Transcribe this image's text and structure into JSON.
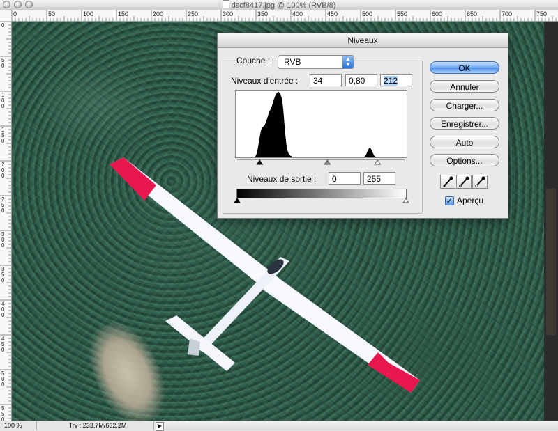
{
  "window": {
    "title": "dscf8417.jpg @ 100% (RVB/8)"
  },
  "rulers": {
    "top_ticks": [
      "0",
      "50",
      "100",
      "150",
      "200",
      "250",
      "300",
      "350",
      "400",
      "450",
      "500",
      "550",
      "600",
      "650",
      "700",
      "750"
    ],
    "left_ticks": [
      "0",
      "50",
      "100",
      "150",
      "200",
      "250",
      "300",
      "350",
      "400",
      "450",
      "500",
      "550"
    ]
  },
  "status": {
    "zoom": "100 %",
    "doc_info": "Trv : 233,7M/632,2M"
  },
  "dialog": {
    "title": "Niveaux",
    "channel_label": "Couche :",
    "channel_value": "RVB",
    "input_label": "Niveaux d'entrée :",
    "input_black": "34",
    "input_gamma": "0,80",
    "input_white": "212",
    "output_label": "Niveaux de sortie :",
    "output_black": "0",
    "output_white": "255",
    "buttons": {
      "ok": "OK",
      "cancel": "Annuler",
      "load": "Charger...",
      "save": "Enregistrer...",
      "auto": "Auto",
      "options": "Options..."
    },
    "preview_label": "Aperçu",
    "preview_checked": true,
    "eyedroppers": [
      "eyedropper-black-icon",
      "eyedropper-gray-icon",
      "eyedropper-white-icon"
    ]
  },
  "histogram": {
    "levels": [
      0,
      0,
      0,
      0,
      0,
      0,
      0,
      0,
      0,
      0,
      0,
      0,
      0,
      0,
      0,
      0,
      0,
      0,
      0,
      0,
      0,
      0,
      0,
      0,
      0,
      0,
      0,
      0,
      0,
      0,
      1,
      2,
      4,
      7,
      11,
      16,
      22,
      28,
      33,
      38,
      41,
      43,
      44,
      45,
      46,
      47,
      49,
      51,
      54,
      57,
      60,
      63,
      66,
      68,
      70,
      72,
      74,
      77,
      80,
      83,
      86,
      89,
      91,
      93,
      94,
      95,
      96,
      96,
      95,
      94,
      92,
      90,
      86,
      80,
      72,
      62,
      50,
      38,
      28,
      20,
      14,
      10,
      7,
      5,
      4,
      3,
      2,
      2,
      1,
      1,
      1,
      1,
      0,
      0,
      0,
      0,
      0,
      0,
      0,
      0,
      0,
      0,
      0,
      0,
      0,
      0,
      0,
      0,
      0,
      0,
      0,
      0,
      0,
      0,
      0,
      0,
      0,
      0,
      0,
      0,
      0,
      0,
      0,
      0,
      0,
      0,
      0,
      0,
      0,
      0,
      0,
      0,
      0,
      0,
      0,
      0,
      0,
      0,
      0,
      0,
      0,
      0,
      0,
      0,
      0,
      0,
      0,
      0,
      0,
      0,
      0,
      0,
      0,
      0,
      0,
      0,
      0,
      0,
      0,
      0,
      0,
      0,
      0,
      0,
      0,
      0,
      0,
      0,
      0,
      0,
      0,
      0,
      0,
      0,
      0,
      0,
      0,
      0,
      0,
      0,
      0,
      0,
      0,
      0,
      0,
      0,
      0,
      0,
      0,
      0,
      0,
      0,
      0,
      0,
      0,
      0,
      0,
      0,
      0,
      0,
      0,
      1,
      2,
      3,
      5,
      7,
      9,
      11,
      13,
      14,
      14,
      13,
      11,
      9,
      7,
      5,
      3,
      2,
      1,
      1,
      0,
      0,
      0,
      0,
      0,
      0,
      0,
      0,
      0,
      0,
      0,
      0,
      0,
      0,
      0,
      0,
      0,
      0,
      0,
      0,
      0,
      0,
      0,
      0,
      0,
      0,
      0,
      0,
      0,
      0,
      0,
      0,
      0,
      0,
      0,
      0,
      0,
      0,
      0,
      0,
      0,
      0,
      0,
      0,
      0,
      0,
      0,
      0
    ]
  },
  "colors": {
    "canvas_forest": "#2c5646",
    "glider_tip": "#e8184f",
    "default_button": "#4a8ce6"
  }
}
